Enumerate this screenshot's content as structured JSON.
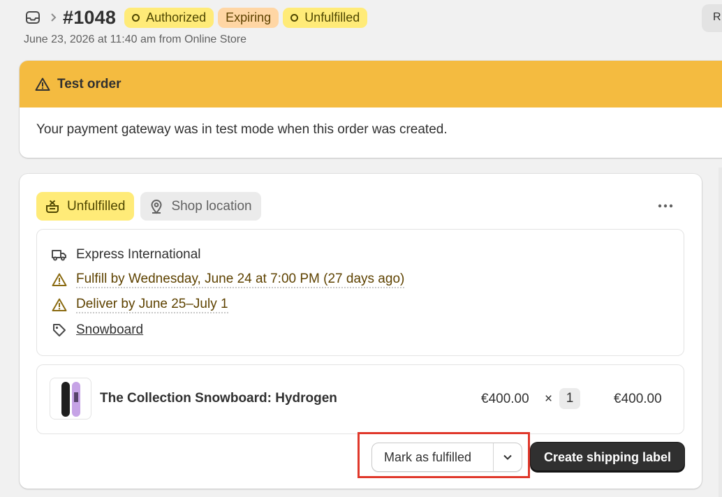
{
  "header": {
    "order_number": "#1048",
    "badges": [
      {
        "label": "Authorized",
        "style": "yellow",
        "icon": "ring-icon"
      },
      {
        "label": "Expiring",
        "style": "orange"
      },
      {
        "label": "Unfulfilled",
        "style": "yellow",
        "icon": "ring-icon"
      }
    ],
    "subline": "June 23, 2026 at 11:40 am from Online Store",
    "right_button_label": "R"
  },
  "banner": {
    "title": "Test order",
    "body": "Your payment gateway was in test mode when this order was created."
  },
  "fulfillment": {
    "status_pill": "Unfulfilled",
    "location_pill": "Shop location",
    "details": {
      "shipping_method": "Express International",
      "fulfill_by": "Fulfill by Wednesday, June 24 at 7:00 PM (27 days ago)",
      "deliver_by": "Deliver by June 25–July 1",
      "tag": "Snowboard"
    },
    "line_item": {
      "name": "The Collection Snowboard: Hydrogen",
      "price": "€400.00",
      "times": "×",
      "quantity": "1",
      "total": "€400.00"
    },
    "actions": {
      "mark_fulfilled": "Mark as fulfilled",
      "create_label": "Create shipping label"
    }
  },
  "colors": {
    "banner_bg": "#f4bb40",
    "badge_yellow": "#ffeb78",
    "badge_orange": "#ffd6a4",
    "primary_button": "#303030",
    "highlight_box": "#e0382b"
  }
}
